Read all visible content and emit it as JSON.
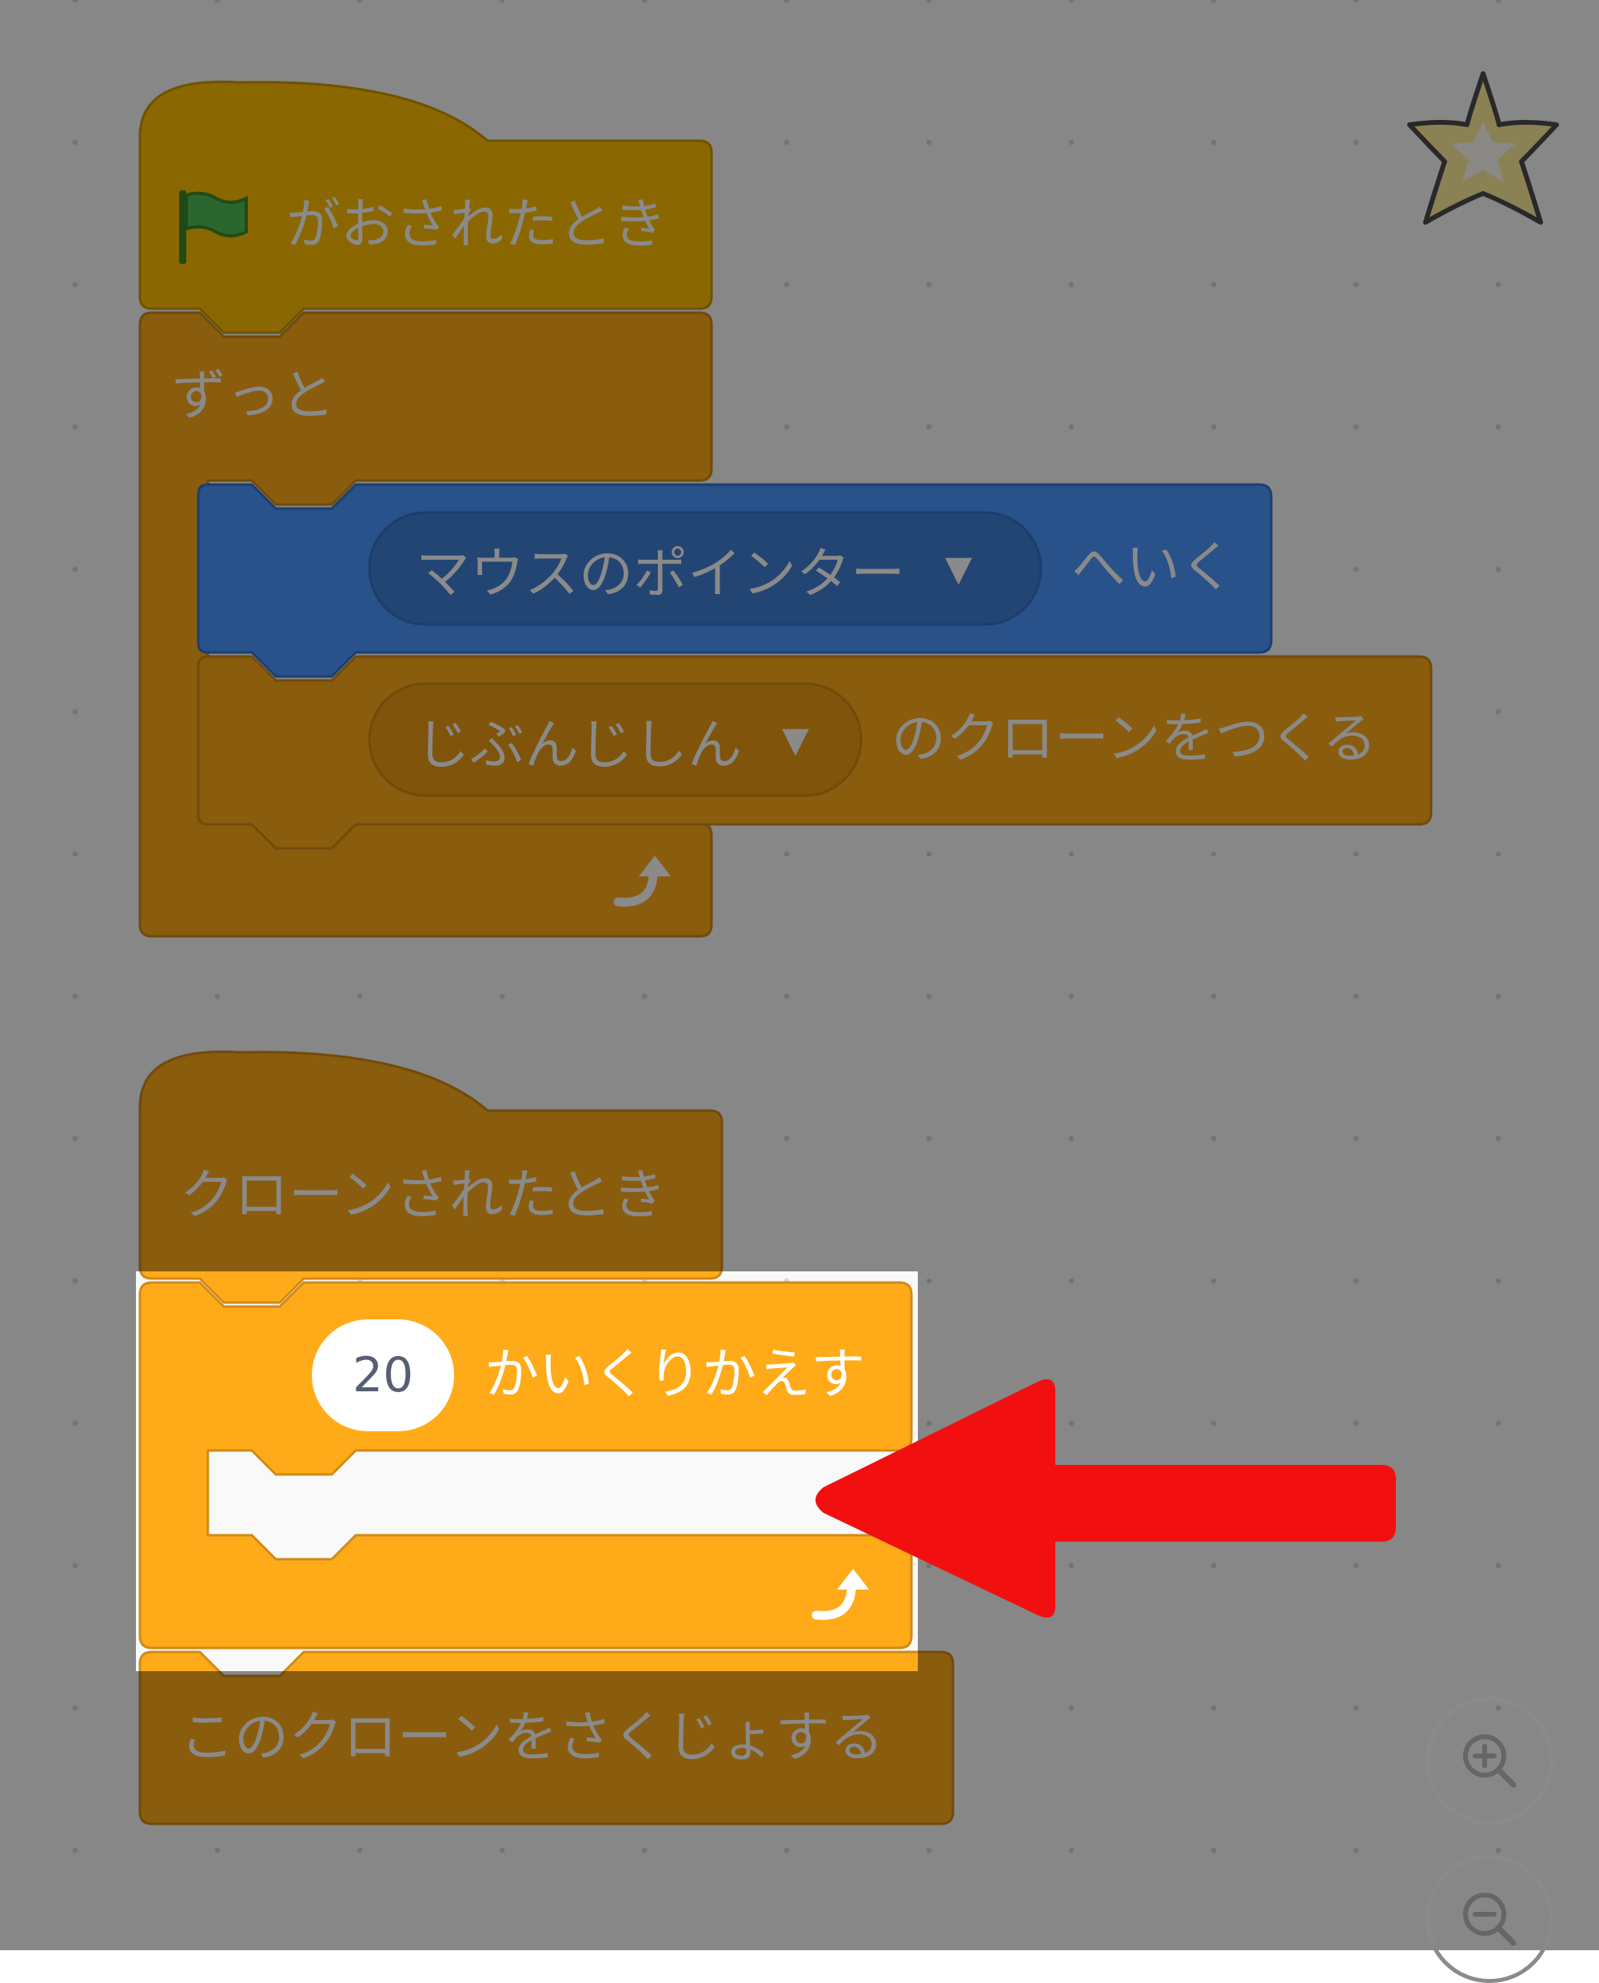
{
  "workspace": {
    "flag_script": {
      "hat_label": "がおされたとき",
      "forever_label": "ずっと",
      "goto_dropdown_value": "マウスのポインター",
      "goto_suffix": "へいく",
      "clone_dropdown_value": "じぶんじしん",
      "clone_suffix": "のクローンをつくる"
    },
    "clone_script": {
      "hat_label": "クローンされたとき",
      "repeat_count": "20",
      "repeat_label": "かいくりかえす",
      "delete_label": "このクローンをさくじょする"
    }
  },
  "controls": {
    "zoom_in_icon": "zoom-in-icon",
    "zoom_out_icon": "zoom-out-icon",
    "favorite_icon": "star-icon"
  },
  "colors": {
    "events": "#ffbf00",
    "control": "#ffab19",
    "motion": "#4c97ff",
    "pointer_arrow": "#f20f0f",
    "workspace": "#f9f9f9"
  }
}
